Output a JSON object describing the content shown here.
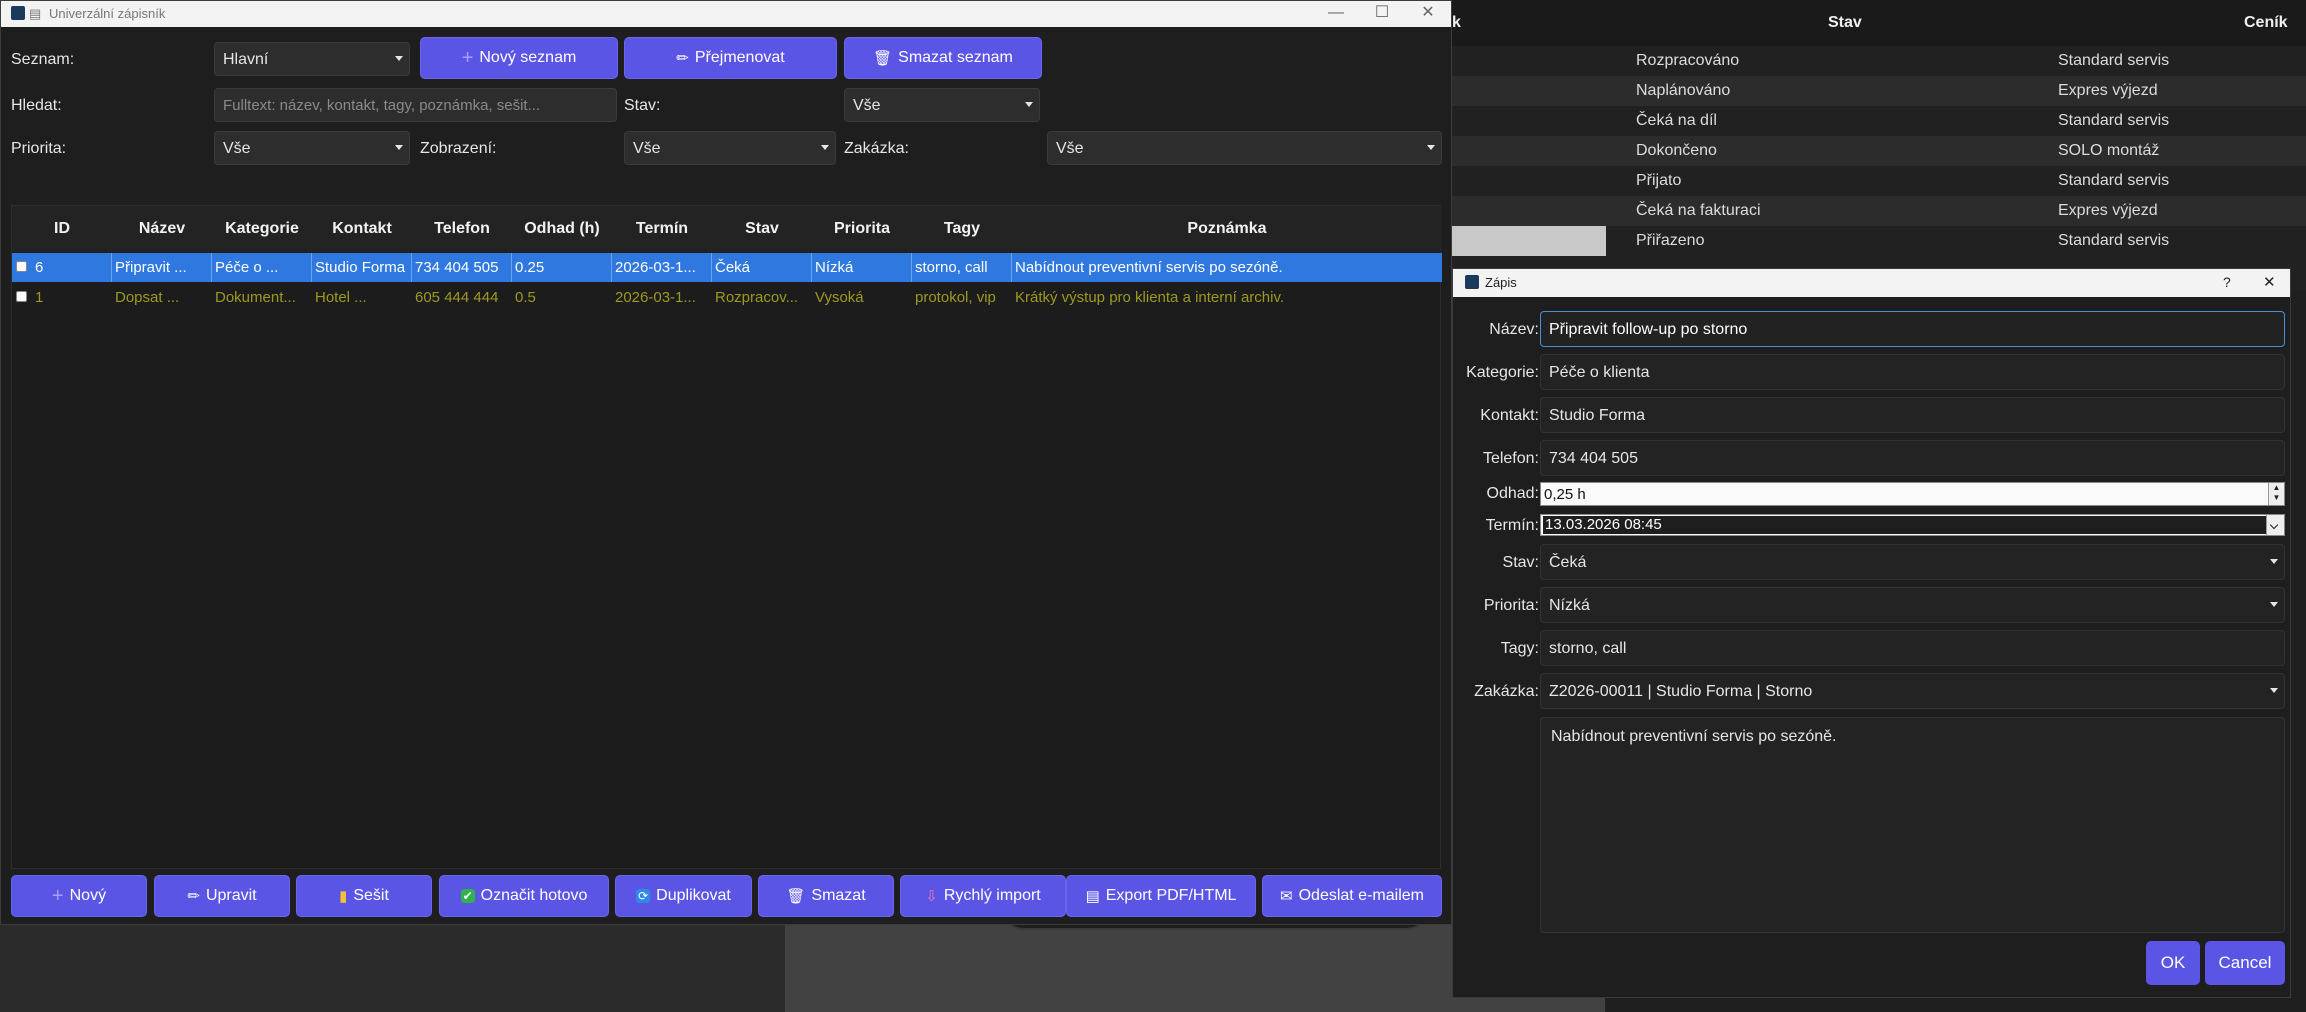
{
  "main_window": {
    "title": "Univerzální zápisník",
    "controls": {
      "minimize": "—",
      "maximize": "☐",
      "close": "✕"
    },
    "seznam_label": "Seznam:",
    "seznam_value": "Hlavní",
    "btn_new_list": "Nový seznam",
    "btn_rename": "Přejmenovat",
    "btn_delete_list": "Smazat seznam",
    "search_label": "Hledat:",
    "search_placeholder": "Fulltext: název, kontakt, tagy, poznámka, sešit...",
    "stav_label": "Stav:",
    "stav_value": "Vše",
    "priorita_label": "Priorita:",
    "priorita_value": "Vše",
    "zobrazeni_label": "Zobrazení:",
    "zobrazeni_value": "Vše",
    "zakazka_label": "Zakázka:",
    "zakazka_value": "Vše"
  },
  "table": {
    "columns": [
      "ID",
      "Název",
      "Kategorie",
      "Kontakt",
      "Telefon",
      "Odhad (h)",
      "Termín",
      "Stav",
      "Priorita",
      "Tagy",
      "Poznámka"
    ],
    "rows": [
      {
        "id": "6",
        "nazev": "Připravit ...",
        "kategorie": "Péče o ...",
        "kontakt": "Studio Forma",
        "telefon": "734 404 505",
        "odhad": "0.25",
        "termin": "2026-03-1...",
        "stav": "Čeká",
        "priorita": "Nízká",
        "tagy": "storno, call",
        "poznamka": "Nabídnout preventivní servis po sezóně."
      },
      {
        "id": "1",
        "nazev": "Dopsat ...",
        "kategorie": "Dokument...",
        "kontakt": "Hotel ...",
        "telefon": "605 444 444",
        "odhad": "0.5",
        "termin": "2026-03-1...",
        "stav": "Rozpracov...",
        "priorita": "Vysoká",
        "tagy": "protokol, vip",
        "poznamka": "Krátký výstup pro klienta a interní archiv."
      }
    ]
  },
  "bottom_buttons": {
    "new": "Nový",
    "edit": "Upravit",
    "notebook": "Sešit",
    "mark_done": "Označit hotovo",
    "duplicate": "Duplikovat",
    "delete": "Smazat",
    "quick_import": "Rychlý import",
    "export": "Export PDF/HTML",
    "email": "Odeslat e-mailem"
  },
  "bg_table": {
    "headers": [
      "k",
      "Stav",
      "Ceník"
    ],
    "rows": [
      {
        "stav": "Rozpracováno",
        "cenik": "Standard servis"
      },
      {
        "stav": "Naplánováno",
        "cenik": "Expres výjezd"
      },
      {
        "stav": "Čeká na díl",
        "cenik": "Standard servis"
      },
      {
        "stav": "Dokončeno",
        "cenik": "SOLO montáž"
      },
      {
        "stav": "Přijato",
        "cenik": "Standard servis"
      },
      {
        "stav": "Čeká na fakturaci",
        "cenik": "Expres výjezd"
      },
      {
        "stav": "Přiřazeno",
        "cenik": "Standard servis"
      }
    ]
  },
  "dialog": {
    "title": "Zápis",
    "help": "?",
    "close": "✕",
    "nazev_label": "Název:",
    "nazev_value": "Připravit follow-up po storno",
    "kategorie_label": "Kategorie:",
    "kategorie_value": "Péče o klienta",
    "kontakt_label": "Kontakt:",
    "kontakt_value": "Studio Forma",
    "telefon_label": "Telefon:",
    "telefon_value": "734 404 505",
    "odhad_label": "Odhad:",
    "odhad_value": "0,25 h",
    "termin_label": "Termín:",
    "termin_value": "13.03.2026 08:45",
    "stav_label": "Stav:",
    "stav_value": "Čeká",
    "priorita_label": "Priorita:",
    "priorita_value": "Nízká",
    "tagy_label": "Tagy:",
    "tagy_value": "storno, call",
    "zakazka_label": "Zakázka:",
    "zakazka_value": "Z2026-00011 | Studio Forma | Storno",
    "note": "Nabídnout preventivní servis po sezóně.",
    "ok": "OK",
    "cancel": "Cancel"
  }
}
